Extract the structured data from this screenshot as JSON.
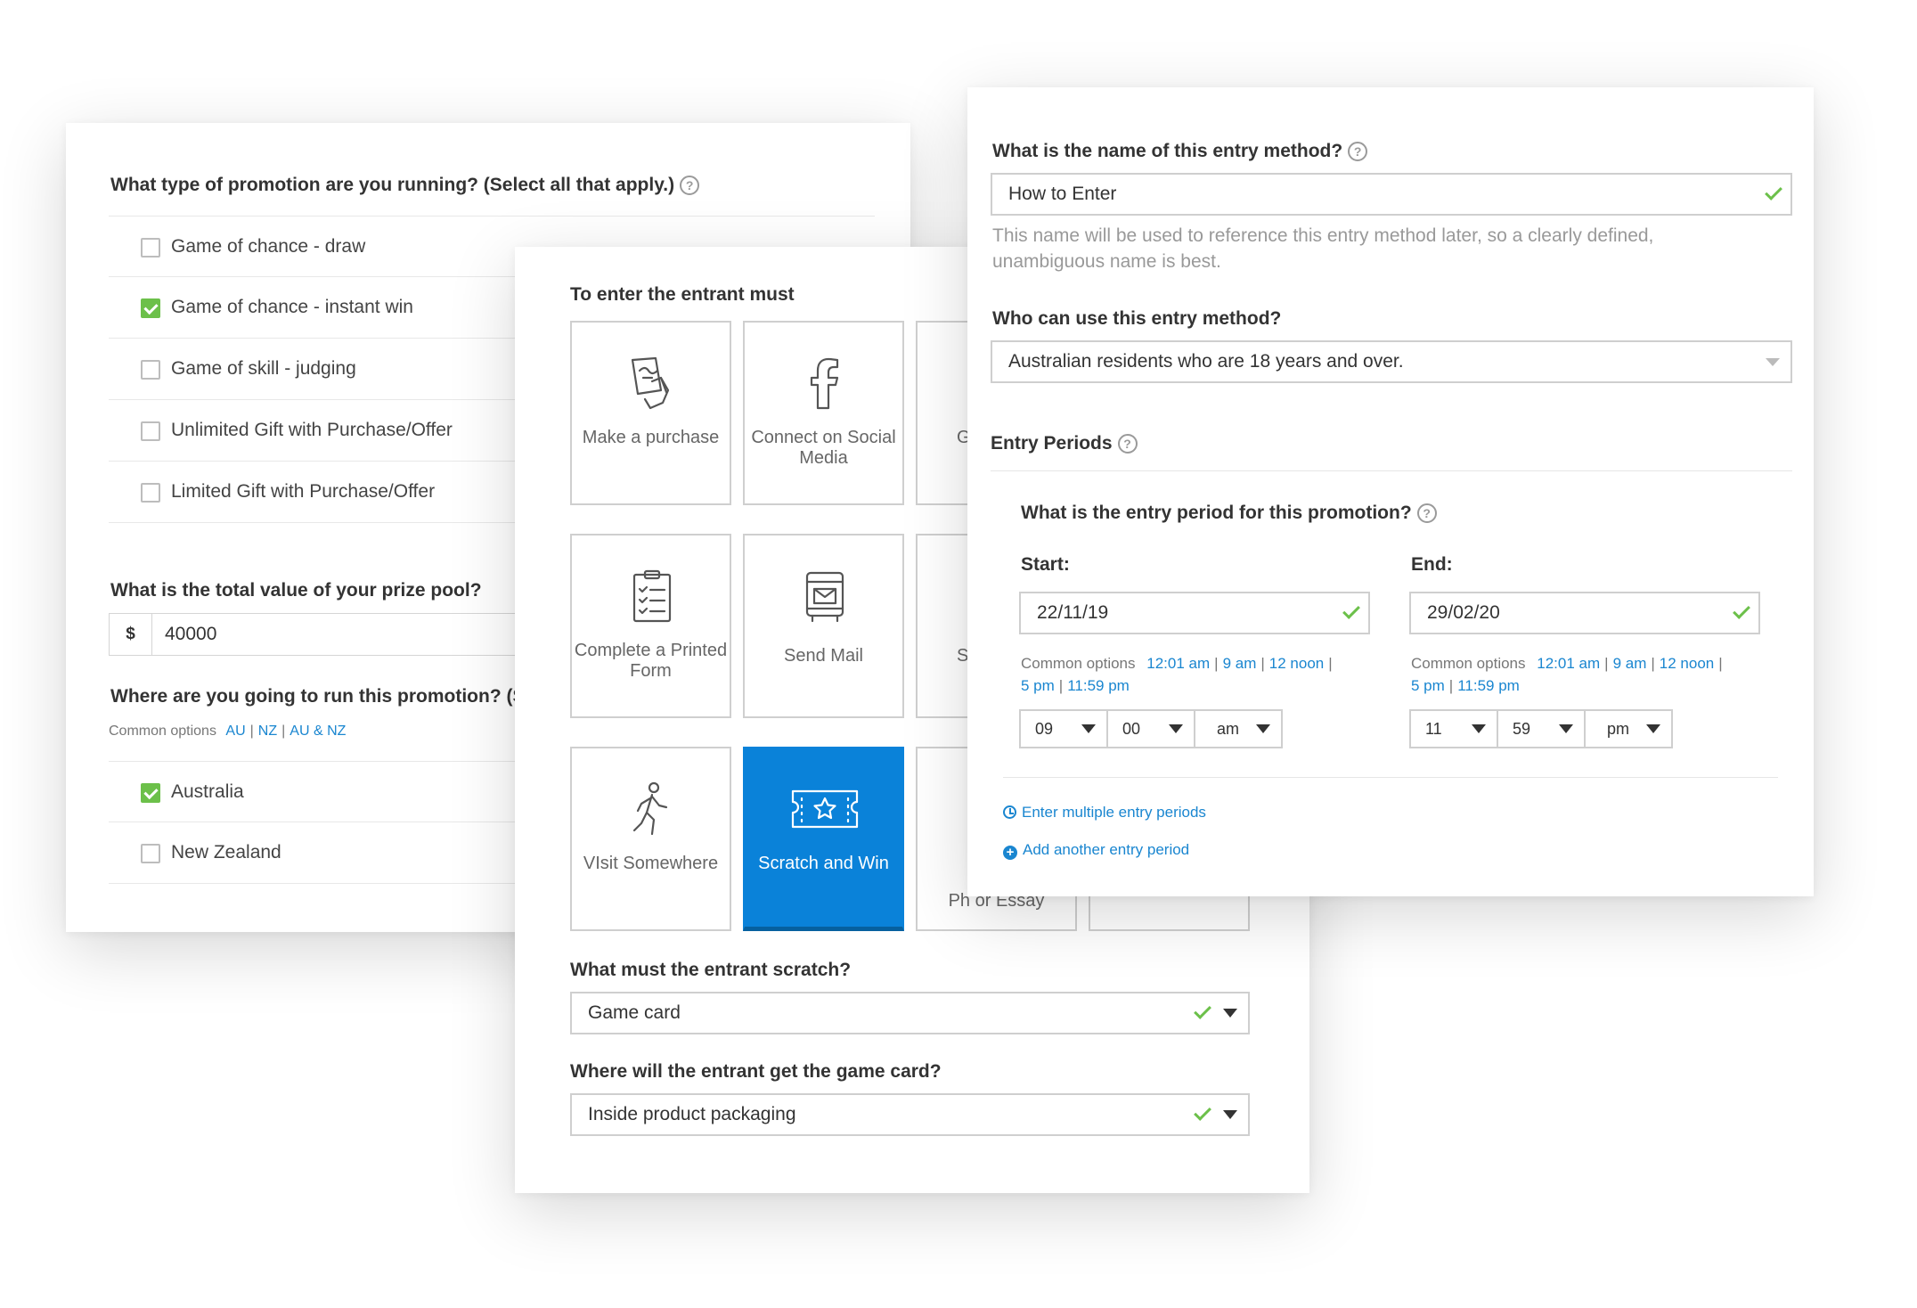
{
  "promo_card": {
    "question_type": "What type of promotion are you running? (Select all that apply.)",
    "promotion_types": [
      {
        "label": "Game of chance - draw",
        "checked": false
      },
      {
        "label": "Game of chance - instant win",
        "checked": true
      },
      {
        "label": "Game of skill - judging",
        "checked": false
      },
      {
        "label": "Unlimited Gift with Purchase/Offer",
        "checked": false
      },
      {
        "label": "Limited Gift with Purchase/Offer",
        "checked": false
      }
    ],
    "question_prize": "What is the total value of your prize pool?",
    "currency_symbol": "$",
    "prize_value": "40000",
    "question_where": "Where are you going to run this promotion? (S",
    "common_options_label": "Common options",
    "region_links": [
      "AU",
      "NZ",
      "AU & NZ"
    ],
    "regions": [
      {
        "label": "Australia",
        "checked": true
      },
      {
        "label": "New Zealand",
        "checked": false
      }
    ]
  },
  "method_card": {
    "heading": "To enter the entrant must",
    "tiles": [
      {
        "label": "Make a purchase",
        "icon": "hand-receipt-icon",
        "selected": false
      },
      {
        "label": "Connect on Social Media",
        "icon": "facebook-icon",
        "selected": false
      },
      {
        "label": "G",
        "icon": "",
        "selected": false
      },
      {
        "label": "Complete a Printed Form",
        "icon": "clipboard-form-icon",
        "selected": false
      },
      {
        "label": "Send Mail",
        "icon": "mailbox-icon",
        "selected": false
      },
      {
        "label": "S",
        "icon": "",
        "selected": false
      },
      {
        "label": "VIsit Somewhere",
        "icon": "walking-person-icon",
        "selected": false
      },
      {
        "label": "Scratch and Win",
        "icon": "ticket-star-icon",
        "selected": true
      },
      {
        "label": "Ph or Essay",
        "icon": "",
        "selected": false
      }
    ],
    "question_scratch": "What must the entrant scratch?",
    "scratch_value": "Game card",
    "question_get": "Where will the entrant get the game card?",
    "get_value": "Inside product packaging"
  },
  "entry_card": {
    "question_name": "What is the name of this entry method?",
    "name_value": "How to Enter",
    "name_hint": "This name will be used to reference this entry method later, so a clearly defined, unambiguous name is best.",
    "question_who": "Who can use this entry method?",
    "who_value": "Australian residents who are 18 years and over.",
    "entry_periods_label": "Entry Periods",
    "question_period": "What is the entry period for this promotion?",
    "start_label": "Start:",
    "start_date": "22/11/19",
    "end_label": "End:",
    "end_date": "29/02/20",
    "common_options_label": "Common options",
    "time_options": [
      "12:01 am",
      "9 am",
      "12 noon",
      "5 pm",
      "11:59 pm"
    ],
    "start_time": {
      "hour": "09",
      "minute": "00",
      "ampm": "am"
    },
    "end_time": {
      "hour": "11",
      "minute": "59",
      "ampm": "pm"
    },
    "multiple_periods_link": "Enter multiple entry periods",
    "add_period_link": "Add another entry period"
  },
  "colors": {
    "accent_blue": "#0a82d9",
    "link_blue": "#1a86d0",
    "check_green": "#6cc04a"
  }
}
